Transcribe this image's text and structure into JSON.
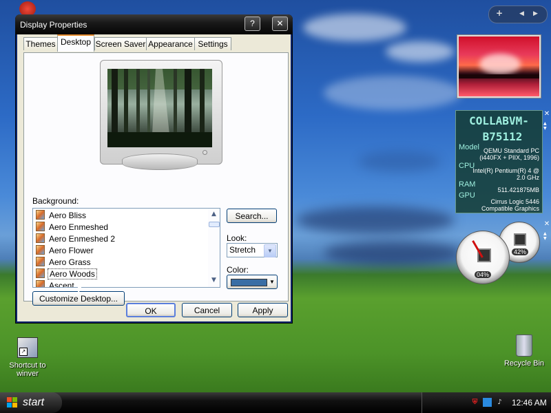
{
  "window": {
    "title": "Display Properties",
    "help_btn": "?",
    "close_btn": "✕",
    "tabs": [
      "Themes",
      "Desktop",
      "Screen Saver",
      "Appearance",
      "Settings"
    ],
    "active_tab": "Desktop"
  },
  "desktop_tab": {
    "background_label": "Background:",
    "backgrounds": [
      "Aero Bliss",
      "Aero Enmeshed",
      "Aero Enmeshed 2",
      "Aero Flower",
      "Aero Grass",
      "Aero Woods",
      "Ascent"
    ],
    "selected_background": "Aero Woods",
    "search_button": "Search...",
    "look_label": "Look:",
    "look_value": "Stretch",
    "color_label": "Color:",
    "color_value": "#3a6ea5",
    "customize_button": "Customize Desktop..."
  },
  "dialog_buttons": {
    "ok": "OK",
    "cancel": "Cancel",
    "apply": "Apply"
  },
  "desktop_icons": {
    "shortcut_label_1": "Shortcut to",
    "shortcut_label_2": "winver",
    "recycle_bin": "Recycle Bin"
  },
  "sidebar": {
    "add_btn": "+",
    "prev_btn": "◀",
    "next_btn": "▶",
    "system_gadget": {
      "hostname_line1": "COLLABVM-",
      "hostname_line2": "B75112",
      "model_label": "Model",
      "model_value_1": "QEMU Standard PC",
      "model_value_2": "(i440FX + PIIX, 1996)",
      "cpu_label": "CPU",
      "cpu_value_1": "Intel(R) Pentium(R) 4 @",
      "cpu_value_2": "2.0 GHz",
      "ram_label": "RAM",
      "ram_value": "511.421875MB",
      "gpu_label": "GPU",
      "gpu_value_1": "Cirrus Logic 5446",
      "gpu_value_2": "Compatible Graphics"
    },
    "cpu_gauge_value": "04%",
    "mem_gauge_value": "42%"
  },
  "taskbar": {
    "start_label": "start",
    "clock": "12:46 AM"
  }
}
